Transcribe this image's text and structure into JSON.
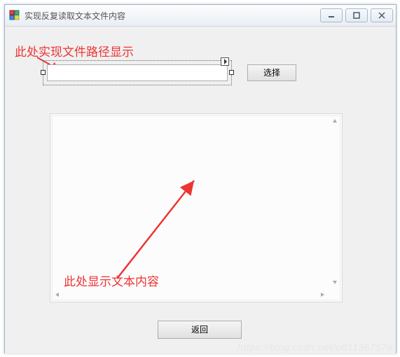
{
  "window": {
    "title": "实现反复读取文本文件内容"
  },
  "annotations": {
    "path_hint": "此处实现文件路径显示",
    "content_hint": "此处显示文本内容"
  },
  "controls": {
    "path_input": {
      "value": "",
      "placeholder": ""
    },
    "select_button": "选择",
    "return_button": "返回"
  },
  "watermark": "https://blog.csdn.net/u011367578"
}
